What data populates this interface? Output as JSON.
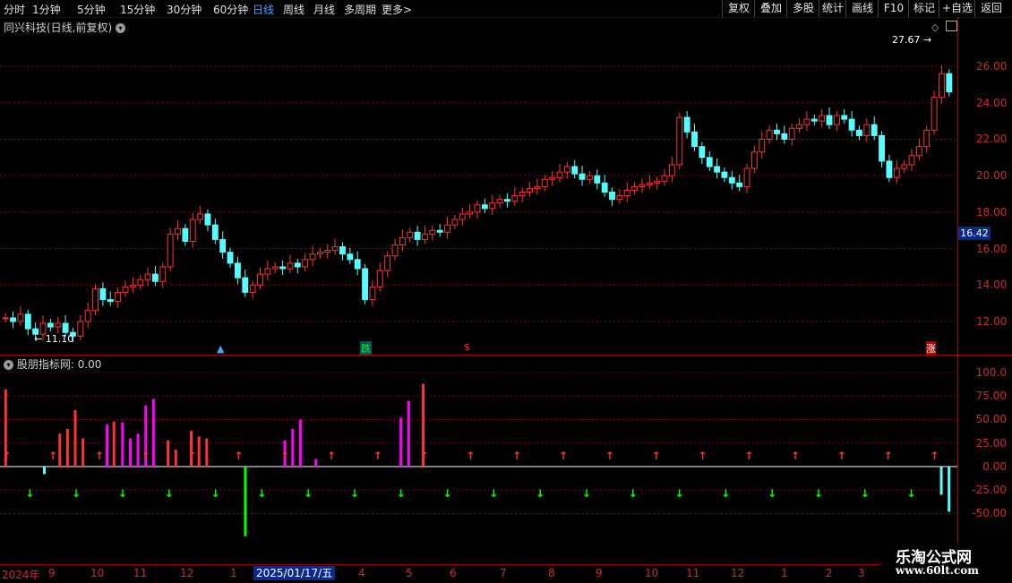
{
  "toolbar": {
    "periods": [
      "分时",
      "1分钟",
      "5分钟",
      "15分钟",
      "30分钟",
      "60分钟",
      "日线",
      "周线",
      "月线",
      "多周期",
      "更多"
    ],
    "active_period": "日线",
    "more_arrow": ">",
    "right_buttons": [
      "复权",
      "叠加",
      "多股",
      "统计",
      "画线",
      "F10",
      "标记",
      "+自选",
      "返回"
    ]
  },
  "main_panel": {
    "title": "同兴科技(日线,前复权)",
    "high_label": "27.67",
    "low_label": "11.10",
    "current_price": "16.42",
    "price_ticks": [
      "26.00",
      "24.00",
      "22.00",
      "20.00",
      "18.00",
      "16.00",
      "14.00",
      "12.00"
    ],
    "markers": {
      "die": "跌",
      "s": "$",
      "zhang": "涨"
    }
  },
  "indicator_panel": {
    "title": "股朋指标网",
    "value": ": 0.00",
    "ticks": [
      "100.0",
      "75.00",
      "50.00",
      "25.00",
      "0.00",
      "-25.00",
      "-50.00"
    ]
  },
  "date_axis": {
    "labels": [
      "2024年",
      "9",
      "10",
      "11",
      "12",
      "1",
      "2025/01/17/五",
      "4",
      "5",
      "6",
      "7",
      "8",
      "9",
      "10",
      "11",
      "12",
      "1",
      "2",
      "3"
    ]
  },
  "watermark": {
    "title": "乐淘公式网",
    "url": "www.60lt.com"
  },
  "colors": {
    "up": "#ff3232",
    "down": "#54ffff",
    "magenta": "#ff00ff",
    "green": "#00ff00",
    "grid": "#8b0000"
  },
  "chart_data": [
    {
      "type": "candlestick",
      "title": "同兴科技(日线,前复权)",
      "ylim": [
        11,
        28
      ],
      "yticks": [
        12,
        14,
        16,
        18,
        20,
        22,
        24,
        26
      ],
      "series": [
        {
          "close": [
            12.2,
            12.0,
            12.4,
            11.6,
            11.3,
            11.9,
            11.7,
            11.9,
            11.4,
            11.2,
            12.0,
            12.6,
            13.8,
            13.2,
            13.1,
            13.6,
            13.9,
            14.0,
            14.3,
            14.6,
            14.2,
            15.0,
            16.8,
            17.1,
            16.4,
            17.6,
            17.9,
            17.3,
            16.5,
            15.8,
            15.2,
            14.4,
            13.6,
            14.0,
            14.6,
            14.9,
            15.0,
            14.9,
            15.2,
            15.0,
            15.4,
            15.7,
            15.8,
            15.9,
            16.1,
            15.7,
            15.4,
            14.9,
            13.2,
            13.9,
            14.8,
            15.6,
            16.2,
            16.6,
            16.9,
            16.5,
            16.8,
            17.0,
            16.9,
            17.3,
            17.6,
            17.9,
            18.0,
            18.4,
            18.2,
            18.5,
            18.7,
            18.6,
            18.9,
            19.1,
            19.3,
            19.4,
            19.8,
            19.9,
            20.2,
            20.5,
            20.1,
            19.8,
            20.0,
            19.6,
            19.1,
            18.7,
            18.9,
            19.2,
            19.4,
            19.5,
            19.6,
            19.7,
            20.0,
            20.6,
            23.2,
            22.4,
            21.6,
            21.0,
            20.5,
            20.2,
            19.9,
            19.6,
            19.4,
            20.4,
            21.3,
            22.0,
            22.5,
            22.3,
            22.0,
            22.6,
            22.8,
            23.1,
            23.0,
            23.3,
            22.8,
            23.3,
            23.1,
            22.5,
            22.2,
            22.8,
            22.2,
            20.8,
            19.9,
            20.4,
            20.6,
            21.1,
            21.6,
            22.5,
            24.3,
            25.6,
            24.6
          ]
        }
      ]
    },
    {
      "type": "bar",
      "title": "股朋指标网",
      "ylim": [
        -60,
        110
      ],
      "yticks": [
        100,
        75,
        50,
        25,
        0,
        -25,
        -50
      ],
      "series": [
        {
          "name": "red",
          "values": [
            82,
            0,
            0,
            0,
            0,
            0,
            0,
            35,
            40,
            60,
            30,
            0,
            0,
            0,
            48,
            0,
            0,
            0,
            0,
            0,
            0,
            28,
            18,
            0,
            38,
            32,
            30,
            0,
            0,
            0,
            0,
            0,
            0,
            0,
            0,
            0,
            0,
            0,
            0,
            0,
            0,
            0,
            0,
            0,
            0,
            0,
            0,
            0,
            0,
            0,
            0,
            0,
            0,
            0,
            88,
            0,
            0,
            0,
            0,
            0,
            0,
            0,
            0,
            0,
            0,
            0,
            0,
            0,
            0,
            0,
            0,
            0,
            0,
            0,
            0,
            0,
            0,
            0,
            0,
            0,
            0,
            0,
            0,
            0,
            0,
            0,
            0,
            0,
            0,
            0,
            0,
            0,
            0,
            0,
            0,
            0,
            0,
            0,
            0,
            0,
            0,
            0,
            0,
            0,
            0,
            0,
            0,
            0,
            0,
            0,
            0,
            0,
            0,
            0,
            0,
            0,
            0,
            0,
            0,
            0,
            0,
            0,
            0
          ]
        },
        {
          "name": "magenta",
          "values": [
            0,
            0,
            0,
            0,
            0,
            0,
            0,
            0,
            0,
            0,
            0,
            0,
            0,
            45,
            0,
            47,
            30,
            35,
            65,
            72,
            0,
            0,
            0,
            0,
            0,
            0,
            0,
            0,
            0,
            0,
            0,
            0,
            0,
            0,
            0,
            0,
            28,
            40,
            50,
            0,
            8,
            0,
            0,
            0,
            0,
            0,
            0,
            0,
            0,
            0,
            0,
            52,
            70,
            0,
            0,
            0,
            0,
            0,
            0,
            0,
            0,
            0,
            0,
            0,
            0,
            0,
            0,
            0,
            0,
            0,
            0,
            0,
            0,
            0,
            0,
            0,
            0,
            0,
            0,
            0,
            0,
            0,
            0,
            0,
            0,
            0,
            0,
            0,
            0,
            0,
            0,
            0,
            0,
            0,
            0,
            0,
            0,
            0,
            0,
            0,
            0,
            0,
            0,
            0,
            0,
            0,
            0,
            0,
            0,
            0,
            0,
            0,
            0,
            0,
            0,
            0,
            0,
            0,
            0,
            0,
            0,
            0,
            0
          ]
        },
        {
          "name": "cyan",
          "values": [
            0,
            0,
            0,
            0,
            0,
            -8,
            0,
            0,
            0,
            0,
            0,
            0,
            0,
            0,
            0,
            0,
            0,
            0,
            0,
            0,
            0,
            0,
            0,
            0,
            0,
            0,
            0,
            0,
            0,
            0,
            0,
            0,
            0,
            0,
            0,
            0,
            0,
            0,
            0,
            0,
            0,
            0,
            0,
            0,
            0,
            0,
            0,
            0,
            0,
            0,
            0,
            0,
            0,
            0,
            0,
            0,
            0,
            0,
            0,
            0,
            0,
            0,
            0,
            0,
            0,
            0,
            0,
            0,
            0,
            0,
            0,
            0,
            0,
            0,
            0,
            0,
            0,
            0,
            0,
            0,
            0,
            0,
            0,
            0,
            0,
            0,
            0,
            0,
            0,
            0,
            0,
            0,
            0,
            0,
            0,
            0,
            0,
            0,
            0,
            0,
            0,
            0,
            0,
            0,
            0,
            0,
            0,
            0,
            0,
            0,
            0,
            0,
            0,
            0,
            0,
            0,
            0,
            0,
            0,
            0,
            0,
            -30,
            -48
          ]
        },
        {
          "name": "green",
          "values": [
            0,
            0,
            0,
            0,
            0,
            0,
            0,
            0,
            0,
            0,
            0,
            0,
            0,
            0,
            0,
            0,
            0,
            0,
            0,
            0,
            0,
            0,
            0,
            0,
            0,
            0,
            0,
            0,
            0,
            0,
            0,
            -74,
            0,
            0,
            0,
            0,
            0,
            0,
            0,
            0,
            0,
            0,
            0,
            0,
            0,
            0,
            0,
            0,
            0,
            0,
            0,
            0,
            0,
            0,
            0,
            0,
            0,
            0,
            0,
            0,
            0,
            0,
            0,
            0,
            0,
            0,
            0,
            0,
            0,
            0,
            0,
            0,
            0,
            0,
            0,
            0,
            0,
            0,
            0,
            0,
            0,
            0,
            0,
            0,
            0,
            0,
            0,
            0,
            0,
            0,
            0,
            0,
            0,
            0,
            0,
            0,
            0,
            0,
            0,
            0,
            0,
            0,
            0,
            0,
            0,
            0,
            0,
            0,
            0,
            0,
            0,
            0,
            0,
            0,
            0,
            0,
            0,
            0,
            0,
            0,
            0,
            0,
            0
          ]
        }
      ]
    }
  ]
}
